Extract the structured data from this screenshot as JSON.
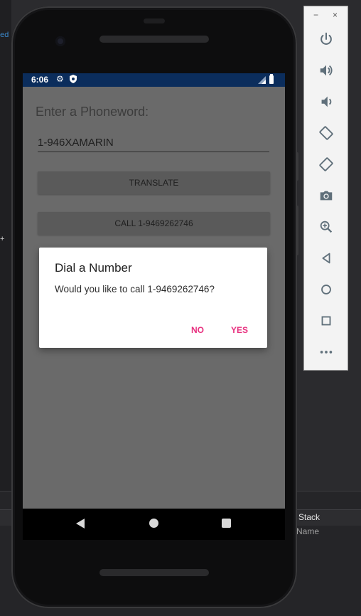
{
  "ide": {
    "stack_label": "Stack",
    "name_label": "Name"
  },
  "status_bar": {
    "time": "6:06",
    "icons": [
      "gear-icon",
      "shield-icon",
      "signal-icon",
      "battery-icon"
    ]
  },
  "app": {
    "prompt_label": "Enter a Phoneword:",
    "phoneword_value": "1-946XAMARIN",
    "translate_button": "TRANSLATE",
    "call_button": "CALL 1-9469262746"
  },
  "dialog": {
    "title": "Dial a Number",
    "message": "Would you like to call 1-9469262746?",
    "no_button": "NO",
    "yes_button": "YES",
    "accent_color": "#e8307f"
  },
  "nav_bar": {
    "icons": [
      "back-icon",
      "home-icon",
      "recents-icon"
    ]
  },
  "emulator_toolbar": {
    "window_controls": [
      "−",
      "×"
    ],
    "icons": [
      "power-icon",
      "volume-up-icon",
      "volume-down-icon",
      "rotate-left-icon",
      "rotate-right-icon",
      "camera-icon",
      "zoom-icon",
      "back-icon",
      "home-icon",
      "overview-icon",
      "more-icon"
    ]
  },
  "colors": {
    "status_bar": "#0b2d5c",
    "screen_bg": "#6a6a6a"
  }
}
